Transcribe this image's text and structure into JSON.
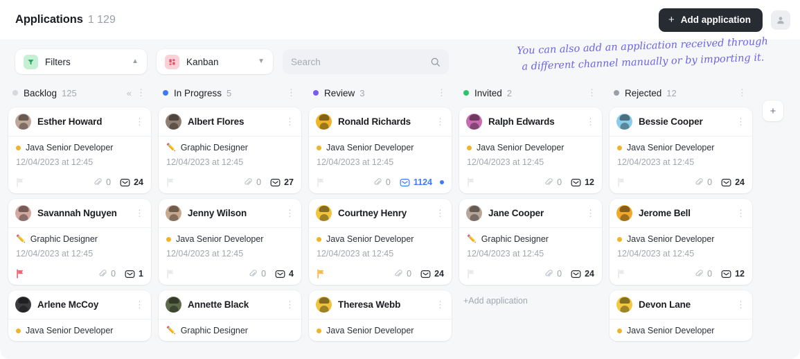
{
  "header": {
    "title": "Applications",
    "count": "1 129",
    "add_button_label": "Add application",
    "add_button_icon": "plus-icon",
    "account_icon": "user-avatar-icon",
    "accent_dark": "#272c33"
  },
  "toolbar": {
    "filters": {
      "label": "Filters",
      "icon": "filter-funnel-icon",
      "chevron": "chevron-up-icon",
      "icon_bg": "#c6f0d3"
    },
    "view": {
      "label": "Kanban",
      "icon": "kanban-grid-icon",
      "chevron": "chevron-down-icon",
      "icon_bg": "#fbd0d6"
    },
    "search": {
      "placeholder": "Search",
      "value": "",
      "icon": "search-icon"
    }
  },
  "annotation": {
    "line1": "You can also add an application received through",
    "line2": "a different channel manually or by importing it.",
    "color": "#6c63e8"
  },
  "board": {
    "add_column_label": "+",
    "columns": [
      {
        "name": "Backlog",
        "count": "125",
        "dot_color": "#d5d8dd",
        "collapse_icon": "collapse-left-icon",
        "menu_icon": "kebab-menu-icon",
        "add_link": "",
        "cards": [
          {
            "name": "Esther Howard",
            "role": "Java Senior Developer",
            "role_type": "dot",
            "date": "12/04/2023 at 12:45",
            "flag_color": "#e8eaee",
            "attachments": "0",
            "messages": "24",
            "messages_active": false,
            "unread": false,
            "avatar_bg": "#bfa79a"
          },
          {
            "name": "Savannah Nguyen",
            "role": "Graphic Designer",
            "role_type": "pen",
            "date": "12/04/2023 at 12:45",
            "flag_color": "#f4647a",
            "attachments": "0",
            "messages": "1",
            "messages_active": false,
            "unread": false,
            "avatar_bg": "#d3a8a0"
          },
          {
            "name": "Arlene McCoy",
            "role": "Java Senior Developer",
            "role_type": "dot",
            "date": "",
            "flag_color": "",
            "attachments": "",
            "messages": "",
            "messages_active": false,
            "unread": false,
            "avatar_bg": "#3b3b3f"
          }
        ]
      },
      {
        "name": "In Progress",
        "count": "5",
        "dot_color": "#3b7cf6",
        "collapse_icon": "",
        "menu_icon": "kebab-menu-icon",
        "add_link": "",
        "cards": [
          {
            "name": "Albert Flores",
            "role": "Graphic Designer",
            "role_type": "pen",
            "date": "12/04/2023 at 12:45",
            "flag_color": "#e8eaee",
            "attachments": "0",
            "messages": "27",
            "messages_active": false,
            "unread": false,
            "avatar_bg": "#8f7f72"
          },
          {
            "name": "Jenny Wilson",
            "role": "Java Senior Developer",
            "role_type": "dot",
            "date": "12/04/2023 at 12:45",
            "flag_color": "#e8eaee",
            "attachments": "0",
            "messages": "4",
            "messages_active": false,
            "unread": false,
            "avatar_bg": "#c7a98d"
          },
          {
            "name": "Annette Black",
            "role": "Graphic Designer",
            "role_type": "pen",
            "date": "",
            "flag_color": "",
            "attachments": "",
            "messages": "",
            "messages_active": false,
            "unread": false,
            "avatar_bg": "#5d6b4a"
          }
        ]
      },
      {
        "name": "Review",
        "count": "3",
        "dot_color": "#7c5cf0",
        "collapse_icon": "",
        "menu_icon": "kebab-menu-icon",
        "add_link": "",
        "cards": [
          {
            "name": "Ronald Richards",
            "role": "Java Senior Developer",
            "role_type": "dot",
            "date": "12/04/2023 at 12:45",
            "flag_color": "#e8eaee",
            "attachments": "0",
            "messages": "1124",
            "messages_active": true,
            "unread": true,
            "avatar_bg": "#f0b429"
          },
          {
            "name": "Courtney Henry",
            "role": "Java Senior Developer",
            "role_type": "dot",
            "date": "12/04/2023 at 12:45",
            "flag_color": "#f5bb4c",
            "attachments": "0",
            "messages": "24",
            "messages_active": false,
            "unread": false,
            "avatar_bg": "#f2c53d"
          },
          {
            "name": "Theresa Webb",
            "role": "Java Senior Developer",
            "role_type": "dot",
            "date": "",
            "flag_color": "",
            "attachments": "",
            "messages": "",
            "messages_active": false,
            "unread": false,
            "avatar_bg": "#f0c33c"
          }
        ]
      },
      {
        "name": "Invited",
        "count": "2",
        "dot_color": "#2cc36b",
        "collapse_icon": "",
        "menu_icon": "kebab-menu-icon",
        "add_link": "+Add application",
        "cards": [
          {
            "name": "Ralph Edwards",
            "role": "Java Senior Developer",
            "role_type": "dot",
            "date": "12/04/2023 at 12:45",
            "flag_color": "#e8eaee",
            "attachments": "0",
            "messages": "12",
            "messages_active": false,
            "unread": false,
            "avatar_bg": "#c86bb0"
          },
          {
            "name": "Jane Cooper",
            "role": "Graphic Designer",
            "role_type": "pen",
            "date": "12/04/2023 at 12:45",
            "flag_color": "#e8eaee",
            "attachments": "0",
            "messages": "24",
            "messages_active": false,
            "unread": false,
            "avatar_bg": "#b8a69a"
          }
        ]
      },
      {
        "name": "Rejected",
        "count": "12",
        "dot_color": "#9aa0ab",
        "collapse_icon": "",
        "menu_icon": "kebab-menu-icon",
        "add_link": "",
        "cards": [
          {
            "name": "Bessie Cooper",
            "role": "Java Senior Developer",
            "role_type": "dot",
            "date": "12/04/2023 at 12:45",
            "flag_color": "#e8eaee",
            "attachments": "0",
            "messages": "24",
            "messages_active": false,
            "unread": false,
            "avatar_bg": "#89cdea"
          },
          {
            "name": "Jerome Bell",
            "role": "Java Senior Developer",
            "role_type": "dot",
            "date": "12/04/2023 at 12:45",
            "flag_color": "#e8eaee",
            "attachments": "0",
            "messages": "12",
            "messages_active": false,
            "unread": false,
            "avatar_bg": "#f0a92c"
          },
          {
            "name": "Devon Lane",
            "role": "Java Senior Developer",
            "role_type": "dot",
            "date": "",
            "flag_color": "",
            "attachments": "",
            "messages": "",
            "messages_active": false,
            "unread": false,
            "avatar_bg": "#f2c93f"
          }
        ]
      }
    ]
  }
}
